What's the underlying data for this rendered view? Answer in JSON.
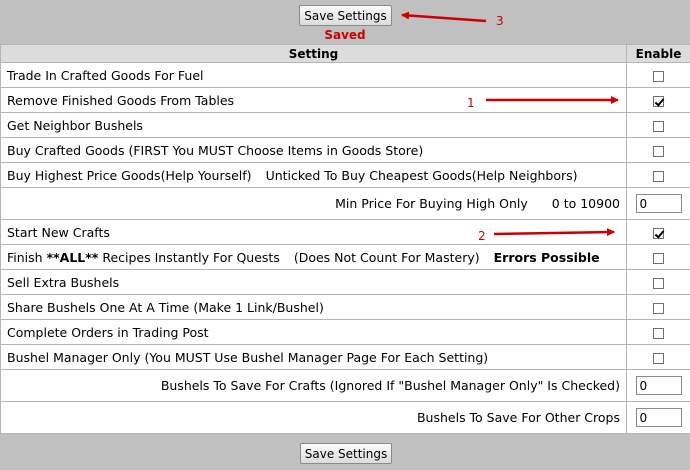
{
  "toolbar": {
    "save_label": "Save Settings",
    "status": "Saved"
  },
  "table": {
    "headers": {
      "setting": "Setting",
      "enable": "Enable"
    },
    "rows": [
      {
        "label": "Trade In Crafted Goods For Fuel",
        "checked": false
      },
      {
        "label": "Remove Finished Goods From Tables",
        "checked": true
      },
      {
        "label": "Get Neighbor Bushels",
        "checked": false
      },
      {
        "label": "Buy Crafted Goods (FIRST You MUST Choose Items in Goods Store)",
        "checked": false
      },
      {
        "label": "Buy Highest Price Goods(Help Yourself)",
        "label_b": "Unticked To Buy Cheapest Goods(Help Neighbors)",
        "checked": false
      },
      {
        "label": "Min Price For Buying High Only",
        "range": "0 to 10900",
        "value": "0"
      },
      {
        "label": "Start New Crafts",
        "checked": true
      },
      {
        "label_pre": "Finish",
        "label_bold": "**ALL**",
        "label_post": "Recipes Instantly For Quests",
        "label_note": "(Does Not Count For Mastery)",
        "label_warn": "Errors Possible",
        "checked": false
      },
      {
        "label": "Sell Extra Bushels",
        "checked": false
      },
      {
        "label": "Share Bushels One At A Time (Make 1 Link/Bushel)",
        "checked": false
      },
      {
        "label": "Complete Orders in Trading Post",
        "checked": false
      },
      {
        "label": "Bushel Manager Only (You MUST Use Bushel Manager Page For Each Setting)",
        "checked": false
      },
      {
        "label": "Bushels To Save For Crafts (Ignored If \"Bushel Manager Only\" Is Checked)",
        "value": "0"
      },
      {
        "label": "Bushels To Save For Other Crops",
        "value": "0"
      }
    ]
  },
  "annotations": {
    "one": "1",
    "two": "2",
    "three": "3",
    "color": "#cc0000"
  }
}
